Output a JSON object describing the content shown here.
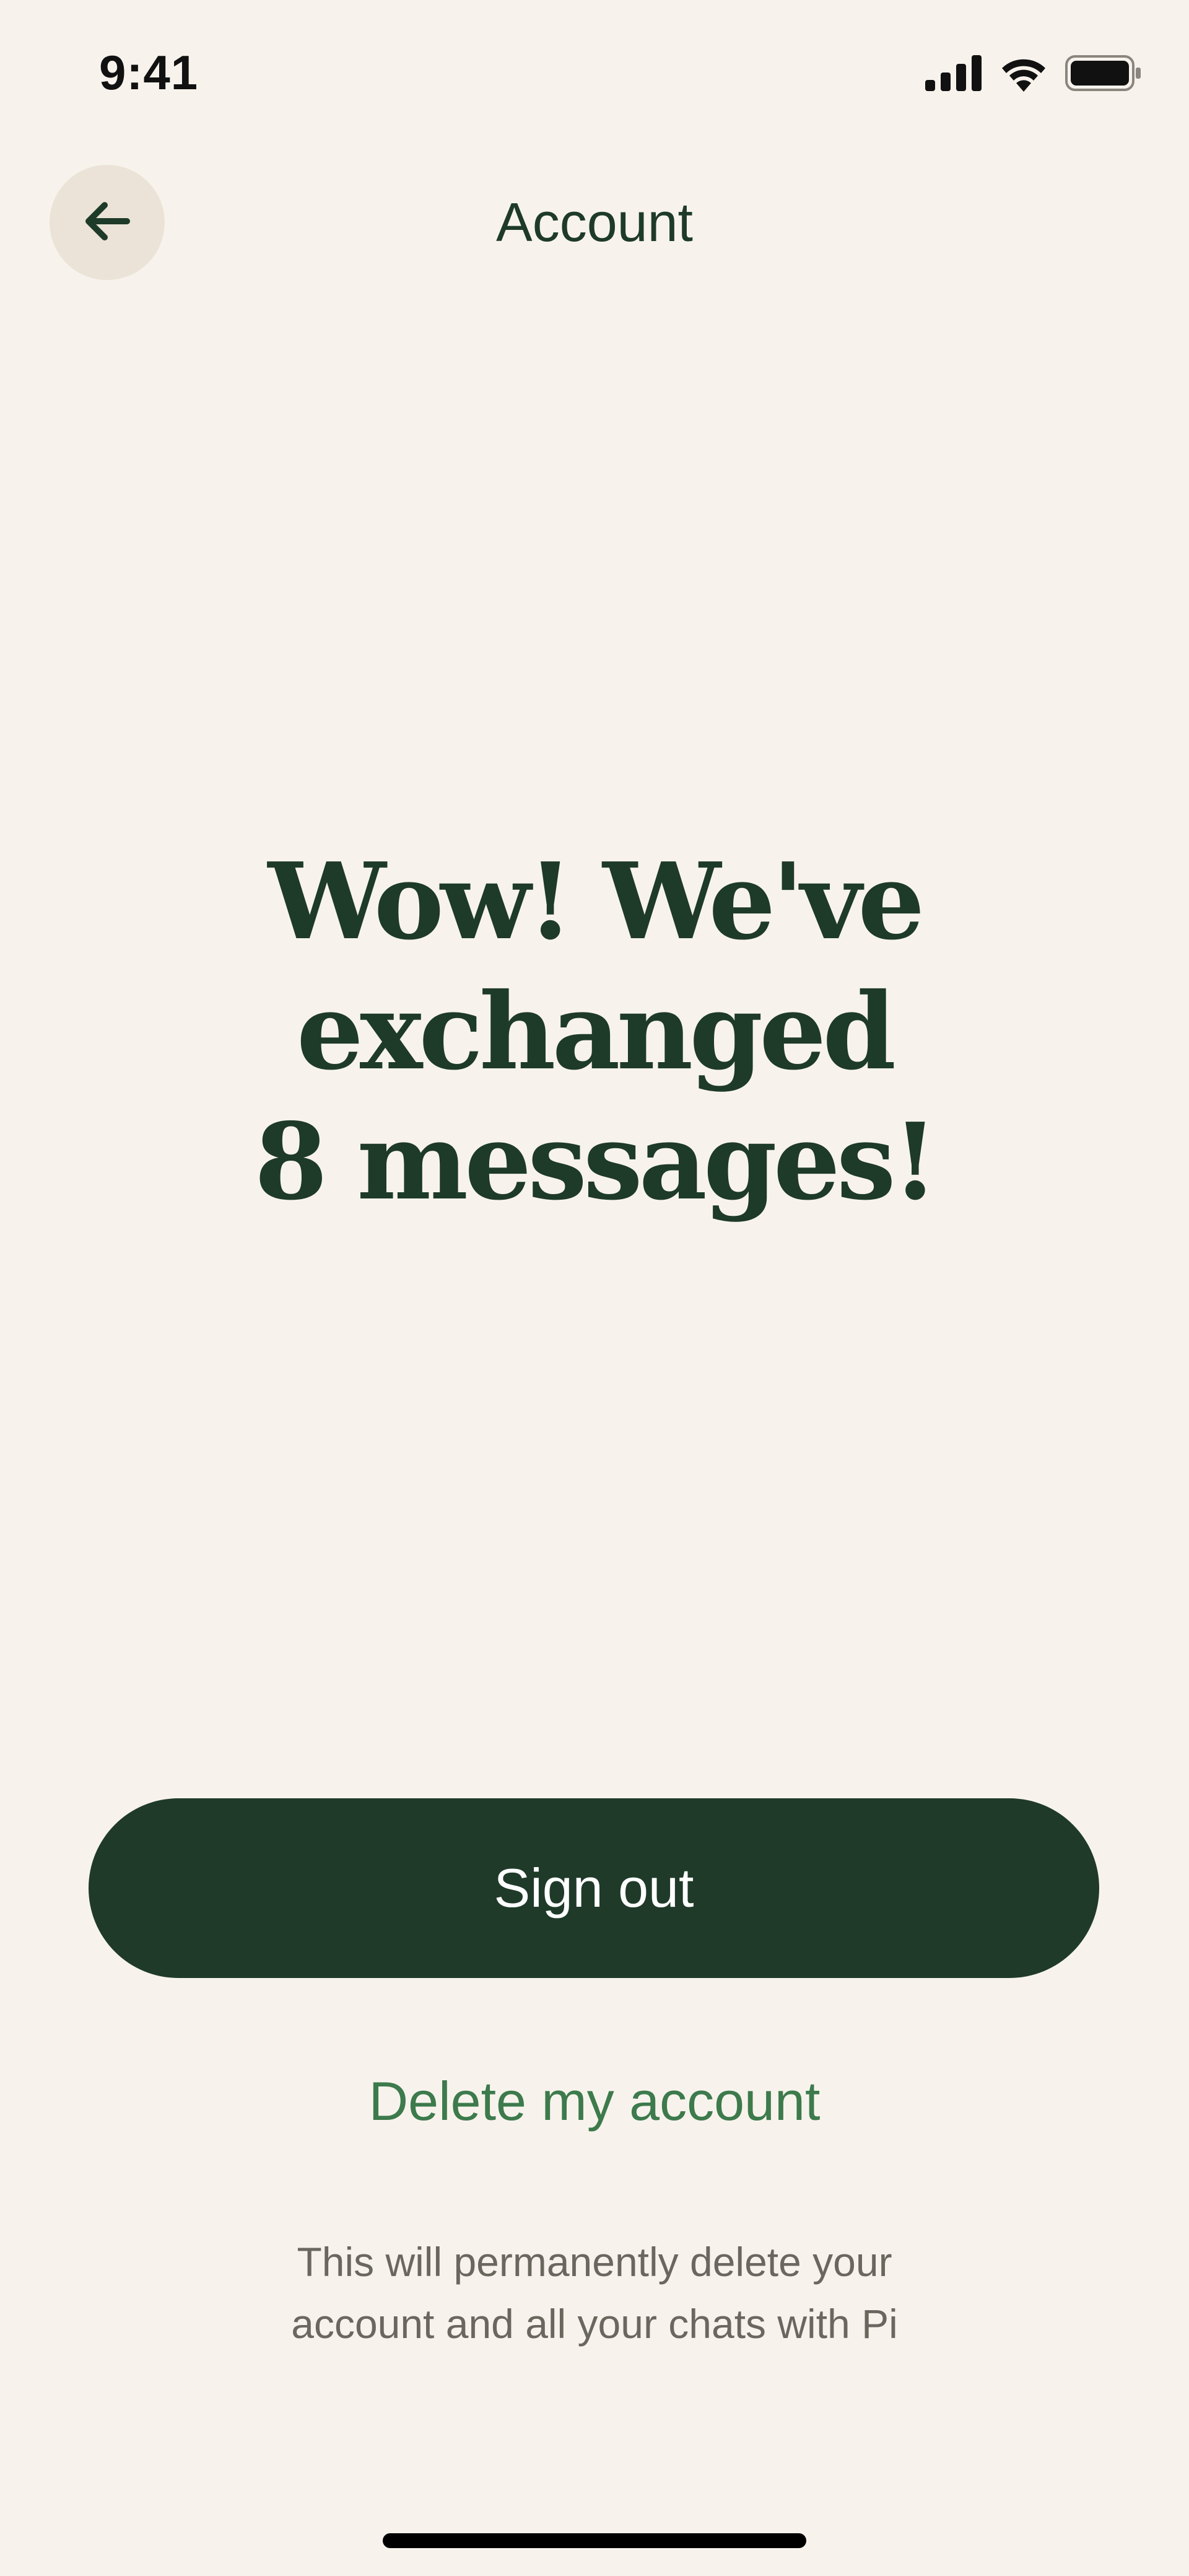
{
  "status_bar": {
    "time": "9:41"
  },
  "header": {
    "title": "Account",
    "back_icon": "arrow-left-icon"
  },
  "main": {
    "headline_line1": "Wow! We've exchanged",
    "headline_line2": "8 messages!"
  },
  "actions": {
    "sign_out_label": "Sign out",
    "delete_label": "Delete my account",
    "delete_note_line1": "This will permanently delete your",
    "delete_note_line2": "account and all your chats with Pi"
  },
  "colors": {
    "background": "#f7f3ec",
    "primary": "#1f3a29",
    "link": "#3d7a4c",
    "muted_text": "#6a675f"
  }
}
